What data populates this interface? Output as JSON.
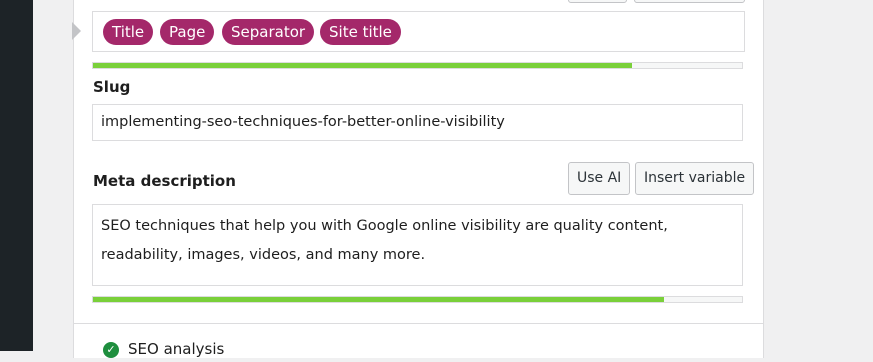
{
  "title_editor": {
    "variables": [
      "Title",
      "Page",
      "Separator",
      "Site title"
    ],
    "progress_percent": 83
  },
  "slug": {
    "label": "Slug",
    "value": "implementing-seo-techniques-for-better-online-visibility"
  },
  "meta_description": {
    "label": "Meta description",
    "use_ai_label": "Use AI",
    "insert_variable_label": "Insert variable",
    "value": "SEO techniques that help you with Google online visibility are quality content, readability, images, videos, and many more.",
    "progress_percent": 88
  },
  "seo_analysis": {
    "label": "SEO analysis",
    "status_icon": "check-circle-icon"
  },
  "colors": {
    "variable_pill": "#a4286a",
    "progress_good": "#7ad03a",
    "admin_sidebar": "#1d2327"
  }
}
